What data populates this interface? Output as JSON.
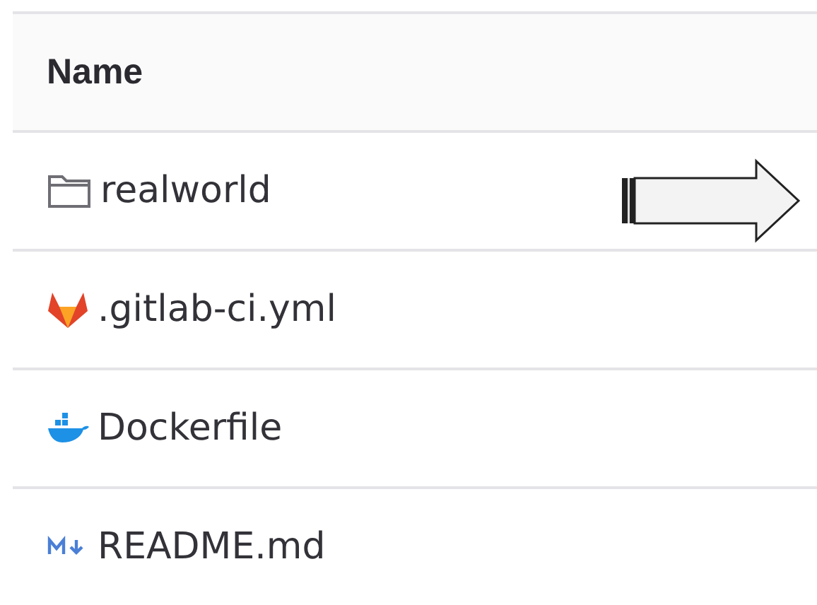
{
  "table": {
    "columns": [
      "Name"
    ],
    "rows": [
      {
        "kind": "folder",
        "name": "realworld",
        "pointer_arrow": true
      },
      {
        "kind": "gitlab",
        "name": ".gitlab-ci.yml",
        "pointer_arrow": false
      },
      {
        "kind": "docker",
        "name": "Dockerfile",
        "pointer_arrow": false
      },
      {
        "kind": "markdown",
        "name": "README.md",
        "pointer_arrow": false
      }
    ]
  }
}
